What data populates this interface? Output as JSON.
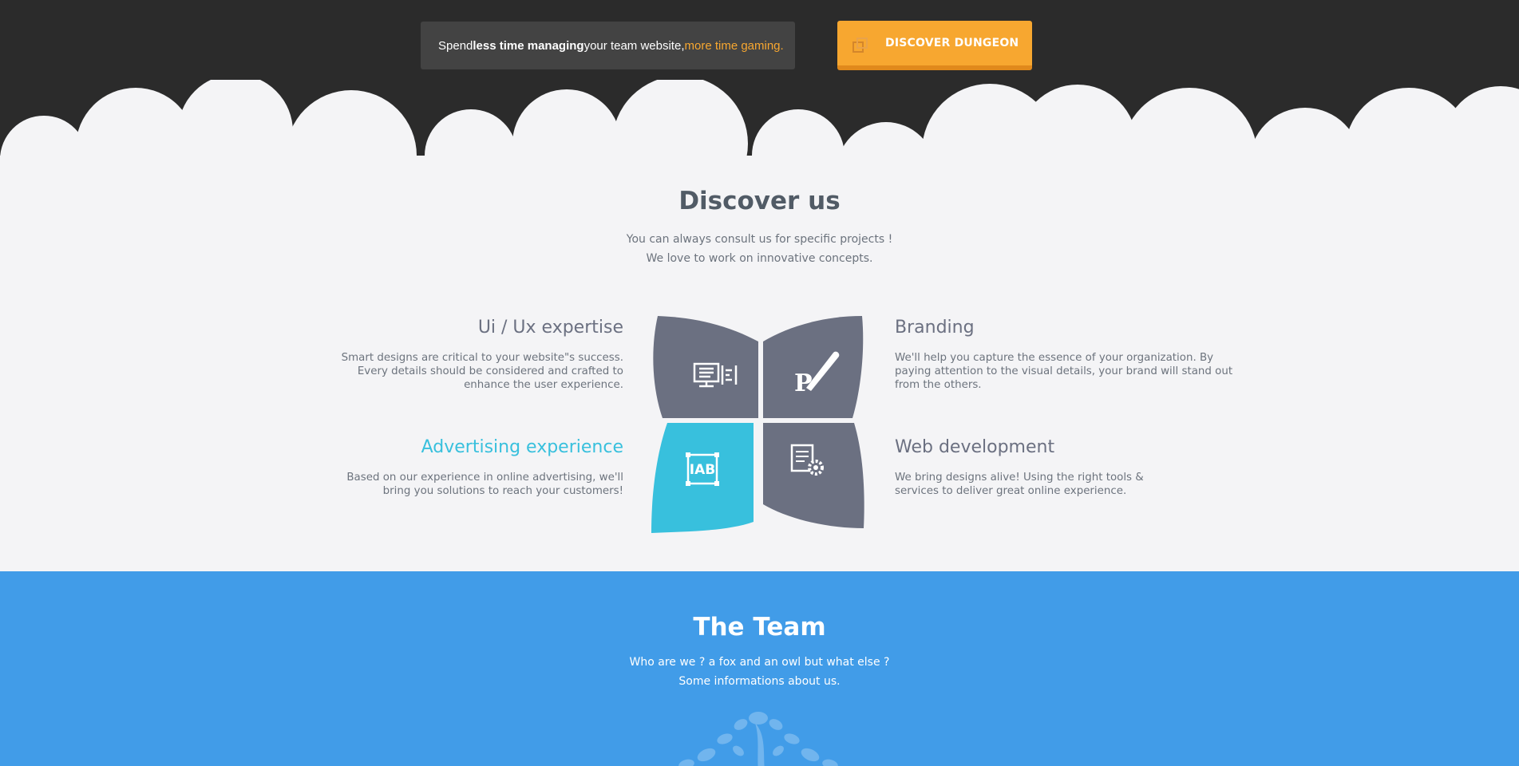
{
  "promo": {
    "pre": "Spend ",
    "bold": "less time managing",
    "mid": " your team website, ",
    "highlight": "more time gaming."
  },
  "cta": {
    "label": "DISCOVER DUNGEON",
    "icon": "copy-icon"
  },
  "discover": {
    "title": "Discover us",
    "subtitle_line1": "You can always consult us for specific projects !",
    "subtitle_line2": "We love to work on innovative concepts.",
    "services": [
      {
        "title": "Ui / Ux expertise",
        "lines": [
          "Smart designs are critical to your website\"s success.",
          "Every details should be considered and crafted to",
          "enhance the user experience."
        ],
        "icon": "monitor-layout-icon"
      },
      {
        "title": "Branding",
        "lines": [
          "We'll help you capture the essence of your organization. By",
          "paying attention to the visual details, your brand will stand out",
          "from the others."
        ],
        "icon": "paintbrush-icon"
      },
      {
        "title": "Advertising experience",
        "lines": [
          "Based on our experience in online advertising, we'll",
          "bring you solutions to reach your customers!"
        ],
        "icon": "iab-icon",
        "icon_text": "IAB"
      },
      {
        "title": "Web development",
        "lines": [
          "We bring designs alive! Using the right tools &",
          "services to deliver great online experience."
        ],
        "icon": "code-gear-icon"
      }
    ],
    "colors": {
      "petal": "#6b7081",
      "accent": "#38c0dd",
      "heading": "#515b66"
    }
  },
  "team": {
    "title": "The Team",
    "subtitle_line1": "Who are we ? a fox and an owl but what else ?",
    "subtitle_line2": "Some informations about us."
  },
  "colors": {
    "dark_bg": "#2b2b2b",
    "cta": "#f7a730",
    "team_bg": "#419ce8",
    "light_bg": "#f4f4f6"
  }
}
